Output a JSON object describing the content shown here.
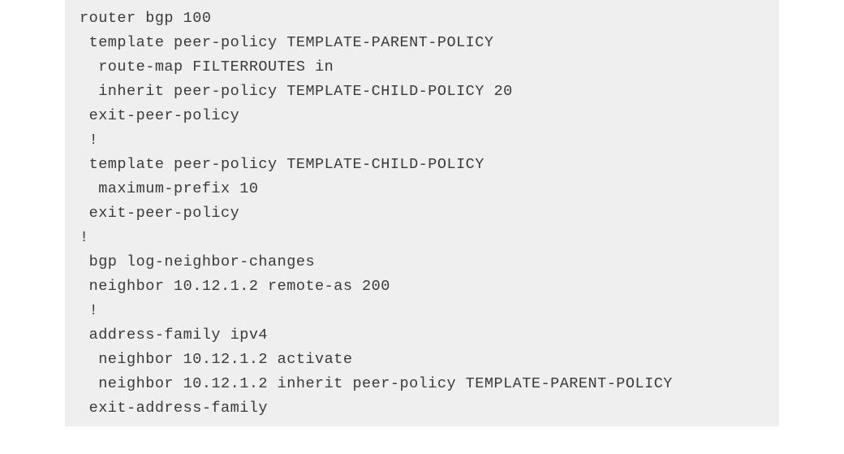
{
  "code": {
    "lines": [
      "router bgp 100",
      " template peer-policy TEMPLATE-PARENT-POLICY",
      "  route-map FILTERROUTES in",
      "  inherit peer-policy TEMPLATE-CHILD-POLICY 20",
      " exit-peer-policy",
      " !",
      " template peer-policy TEMPLATE-CHILD-POLICY",
      "  maximum-prefix 10",
      " exit-peer-policy",
      "!",
      " bgp log-neighbor-changes",
      " neighbor 10.12.1.2 remote-as 200",
      " !",
      " address-family ipv4",
      "  neighbor 10.12.1.2 activate",
      "  neighbor 10.12.1.2 inherit peer-policy TEMPLATE-PARENT-POLICY",
      " exit-address-family"
    ]
  }
}
